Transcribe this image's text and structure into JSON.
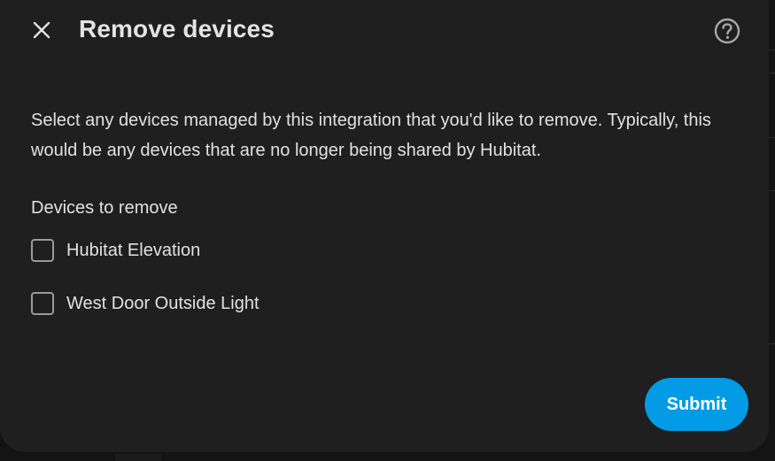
{
  "dialog": {
    "title": "Remove devices",
    "close_icon": "close-icon",
    "help_icon": "help-circle-icon",
    "description": "Select any devices managed by this integration that you'd like to remove. Typically, this would be any devices that are no longer being shared by Hubitat.",
    "field_label": "Devices to remove",
    "options": [
      {
        "label": "Hubitat Elevation",
        "checked": false
      },
      {
        "label": "West Door Outside Light",
        "checked": false
      }
    ],
    "submit_label": "Submit",
    "accent_color": "#039be5"
  }
}
